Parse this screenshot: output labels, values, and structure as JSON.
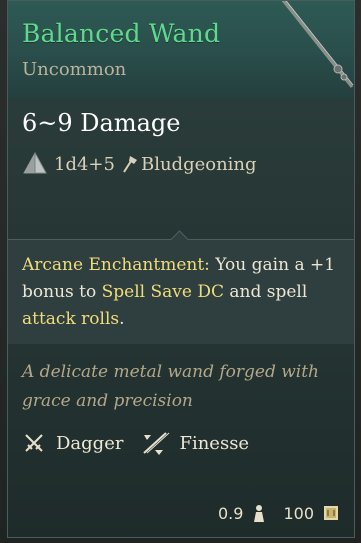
{
  "item": {
    "title": "Balanced Wand",
    "rarity": "Uncommon",
    "damage": "6~9 Damage",
    "dice": "1d4+5",
    "damage_type": "Bludgeoning",
    "enchantment": {
      "name": "Arcane Enchantment:",
      "text_1": " You gain a +1 bonus to ",
      "highlight_1": "Spell Save DC",
      "text_2": " and spell ",
      "highlight_2": "attack rolls",
      "text_3": "."
    },
    "description": "A delicate metal wand forged with grace and precision",
    "properties": [
      {
        "label": "Dagger",
        "icon": "crossed-daggers-icon"
      },
      {
        "label": "Finesse",
        "icon": "finesse-icon"
      }
    ],
    "weight": "0.9",
    "value": "100"
  },
  "colors": {
    "title": "#5fd98b",
    "rarity": "#b9b39c",
    "highlight": "#f0dc7a",
    "description": "#b3a78a"
  }
}
